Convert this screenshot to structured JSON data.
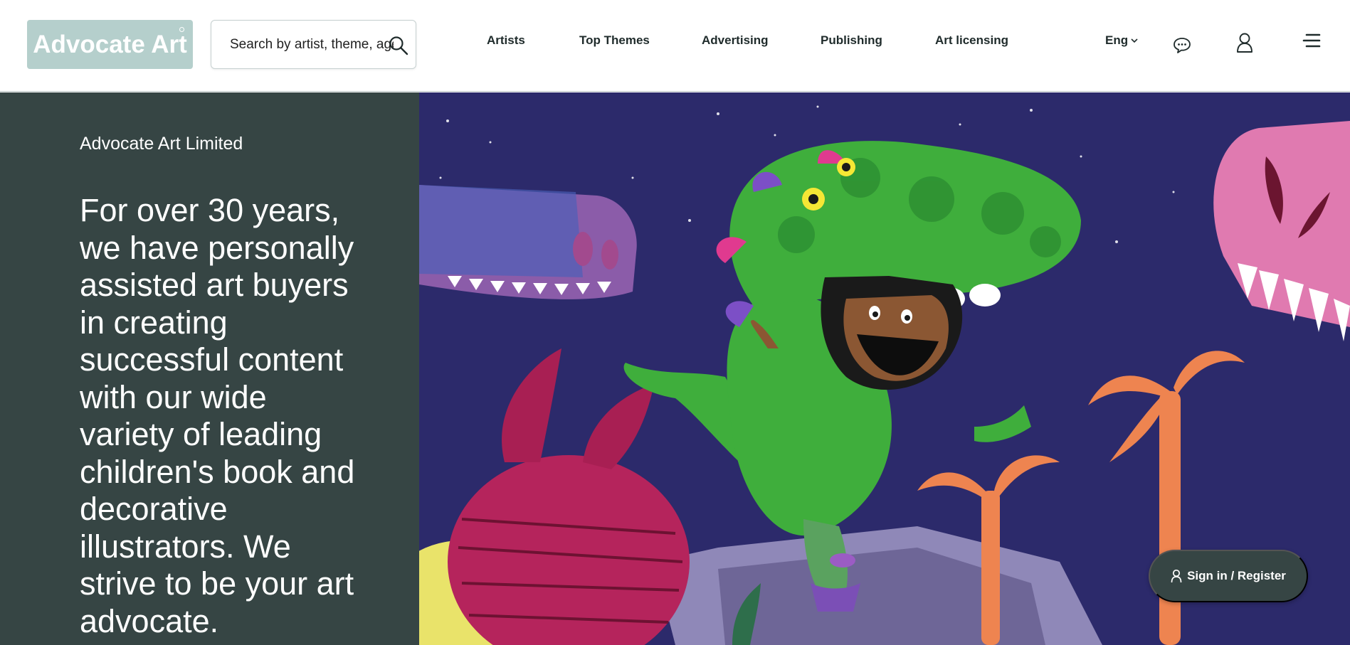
{
  "brand": {
    "logo_text": "Advocate Art"
  },
  "search": {
    "placeholder": "Search by artist, theme, agent"
  },
  "nav": {
    "items": [
      {
        "label": "Artists"
      },
      {
        "label": "Top Themes"
      },
      {
        "label": "Advertising"
      },
      {
        "label": "Publishing"
      },
      {
        "label": "Art licensing"
      }
    ],
    "language": "Eng"
  },
  "hero": {
    "company": "Advocate Art Limited",
    "headline": "For over 30 years, we have personally assisted art buyers in creating successful content with our wide variety of leading children's book and decorative illustrators. We strive to be your art advocate."
  },
  "signin": {
    "label": "Sign in / Register"
  },
  "colors": {
    "logo_bg": "#b5cfcc",
    "panel_bg": "#364544",
    "illustration_sky": "#2c2a6b"
  },
  "icons": [
    "search-icon",
    "chevron-down-icon",
    "chat-icon",
    "user-icon",
    "menu-icon"
  ]
}
